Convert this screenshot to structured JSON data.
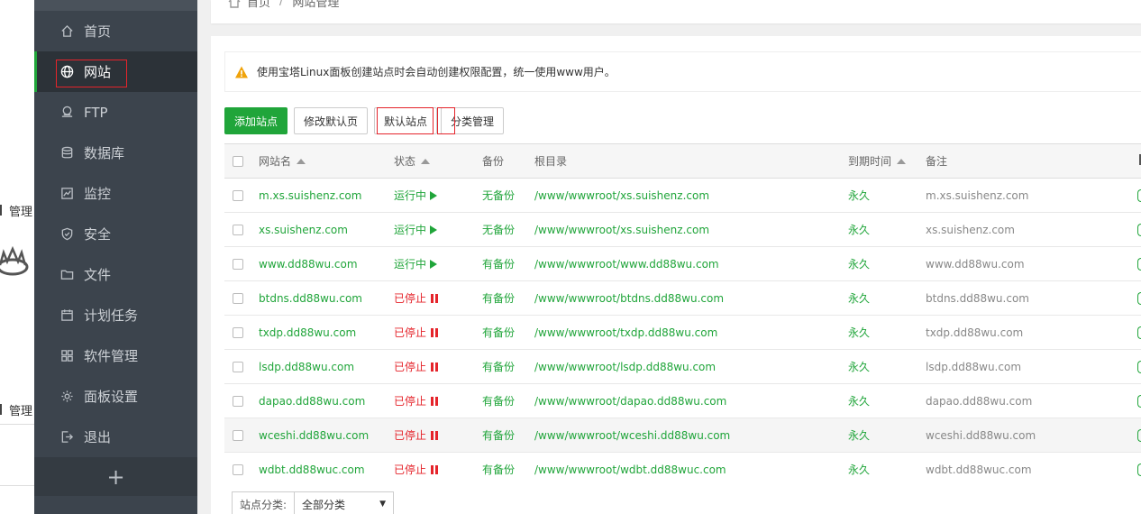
{
  "left_strip": {
    "label_top": "管理",
    "label_bottom": "管理"
  },
  "sidebar": {
    "items": [
      {
        "label": "首页",
        "icon": "home-icon"
      },
      {
        "label": "网站",
        "icon": "globe-icon",
        "active": true
      },
      {
        "label": "FTP",
        "icon": "ftp-icon"
      },
      {
        "label": "数据库",
        "icon": "database-icon"
      },
      {
        "label": "监控",
        "icon": "monitor-icon"
      },
      {
        "label": "安全",
        "icon": "shield-icon"
      },
      {
        "label": "文件",
        "icon": "folder-icon"
      },
      {
        "label": "计划任务",
        "icon": "calendar-icon"
      },
      {
        "label": "软件管理",
        "icon": "apps-icon"
      },
      {
        "label": "面板设置",
        "icon": "gear-icon"
      },
      {
        "label": "退出",
        "icon": "logout-icon"
      }
    ],
    "add": "+"
  },
  "breadcrumb": {
    "home": "首页",
    "sep": "/",
    "current": "网站管理"
  },
  "notice": "使用宝塔Linux面板创建站点时会自动创建权限配置，统一使用www用户。",
  "buttons": {
    "add_site": "添加站点",
    "edit_default_page": "修改默认页",
    "default_site": "默认站点",
    "category_manage": "分类管理"
  },
  "table": {
    "headers": {
      "name": "网站名",
      "status": "状态",
      "backup": "备份",
      "root": "根目录",
      "expire": "到期时间",
      "note": "备注"
    },
    "rows": [
      {
        "name": "m.xs.suishenz.com",
        "status": "运行中",
        "running": true,
        "backup": "无备份",
        "root": "/www/wwwroot/xs.suishenz.com",
        "expire": "永久",
        "note": "m.xs.suishenz.com"
      },
      {
        "name": "xs.suishenz.com",
        "status": "运行中",
        "running": true,
        "backup": "无备份",
        "root": "/www/wwwroot/xs.suishenz.com",
        "expire": "永久",
        "note": "xs.suishenz.com"
      },
      {
        "name": "www.dd88wu.com",
        "status": "运行中",
        "running": true,
        "backup": "有备份",
        "root": "/www/wwwroot/www.dd88wu.com",
        "expire": "永久",
        "note": "www.dd88wu.com"
      },
      {
        "name": "btdns.dd88wu.com",
        "status": "已停止",
        "running": false,
        "backup": "有备份",
        "root": "/www/wwwroot/btdns.dd88wu.com",
        "expire": "永久",
        "note": "btdns.dd88wu.com"
      },
      {
        "name": "txdp.dd88wu.com",
        "status": "已停止",
        "running": false,
        "backup": "有备份",
        "root": "/www/wwwroot/txdp.dd88wu.com",
        "expire": "永久",
        "note": "txdp.dd88wu.com"
      },
      {
        "name": "lsdp.dd88wu.com",
        "status": "已停止",
        "running": false,
        "backup": "有备份",
        "root": "/www/wwwroot/lsdp.dd88wu.com",
        "expire": "永久",
        "note": "lsdp.dd88wu.com"
      },
      {
        "name": "dapao.dd88wu.com",
        "status": "已停止",
        "running": false,
        "backup": "有备份",
        "root": "/www/wwwroot/dapao.dd88wu.com",
        "expire": "永久",
        "note": "dapao.dd88wu.com"
      },
      {
        "name": "wceshi.dd88wu.com",
        "status": "已停止",
        "running": false,
        "backup": "有备份",
        "root": "/www/wwwroot/wceshi.dd88wu.com",
        "expire": "永久",
        "note": "wceshi.dd88wu.com",
        "highlight": true
      },
      {
        "name": "wdbt.dd88wuc.com",
        "status": "已停止",
        "running": false,
        "backup": "有备份",
        "root": "/www/wwwroot/wdbt.dd88wuc.com",
        "expire": "永久",
        "note": "wdbt.dd88wuc.com"
      }
    ]
  },
  "category_filter": {
    "label": "站点分类:",
    "selected": "全部分类"
  },
  "colors": {
    "accent": "#20a53a",
    "stopped": "#e5242b",
    "sidebar": "#3c444d",
    "highlight_box": "#e5242b"
  }
}
